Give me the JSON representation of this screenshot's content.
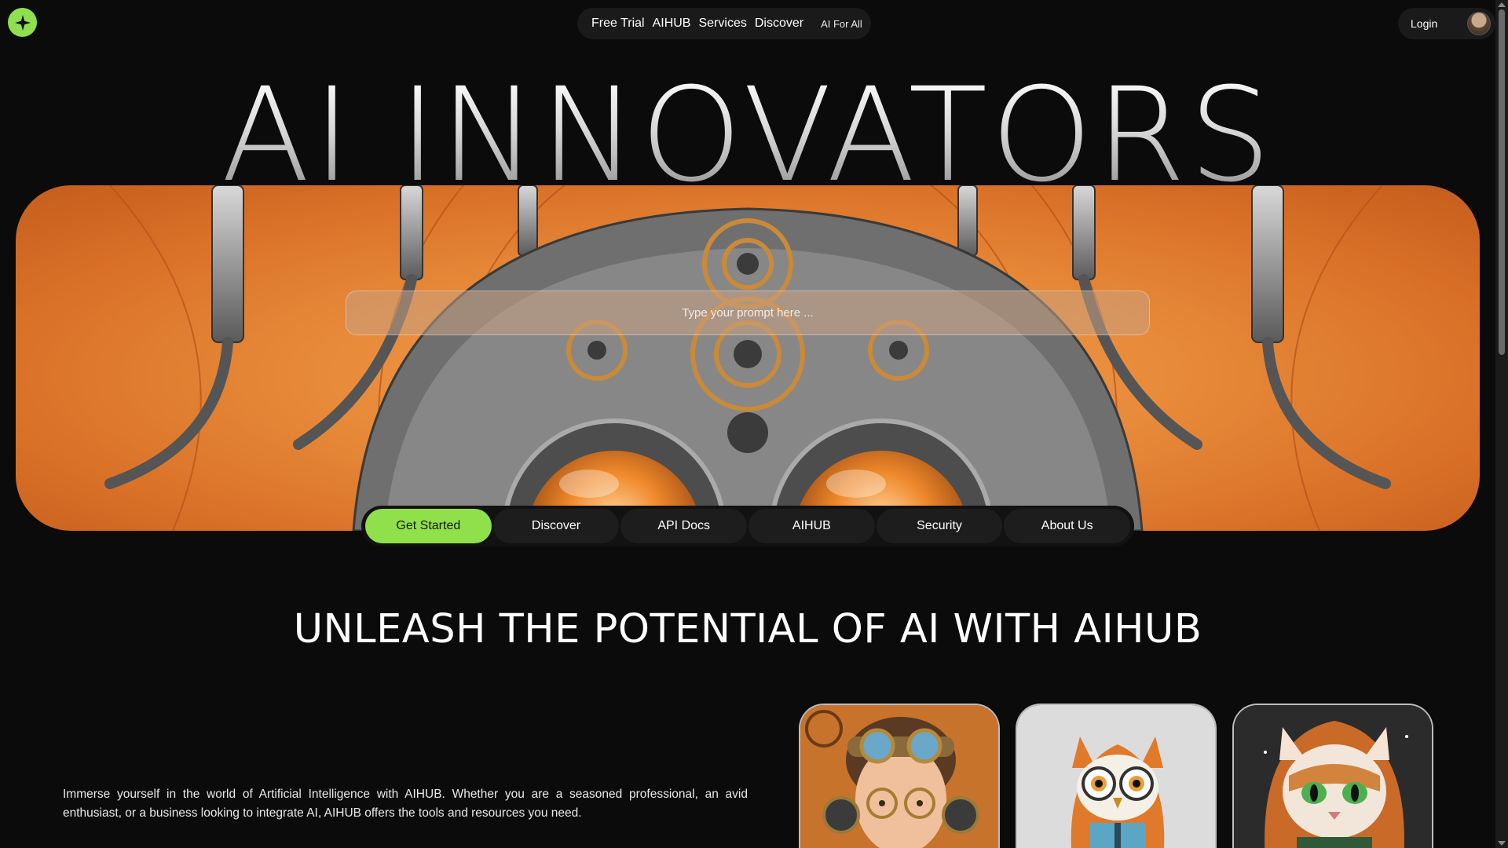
{
  "nav": {
    "logo_icon": "sparkle-icon",
    "items": [
      "Free Trial",
      "AIHUB",
      "Services",
      "Discover"
    ],
    "tagline": "AI For All",
    "accent_color": "#8ee04e"
  },
  "user": {
    "login_label": "Login",
    "avatar_icon": "user-avatar"
  },
  "hero": {
    "title": "AI INNOVATORS",
    "prompt_placeholder": "Type your prompt here ...",
    "image_theme": "steampunk-mechanical-robot-orange"
  },
  "tabs": [
    {
      "label": "Get Started",
      "active": true
    },
    {
      "label": "Discover",
      "active": false
    },
    {
      "label": "API Docs",
      "active": false
    },
    {
      "label": "AIHUB",
      "active": false
    },
    {
      "label": "Security",
      "active": false
    },
    {
      "label": "About Us",
      "active": false
    }
  ],
  "section": {
    "title": "UNLEASH THE POTENTIAL OF AI WITH AIHUB",
    "description": "Immerse yourself in the world of Artificial Intelligence with AIHUB. Whether you are a seasoned professional, an avid enthusiast, or a business looking to integrate AI, AIHUB offers the tools and resources you need."
  },
  "cards": [
    {
      "subject": "steampunk-boy-with-goggles"
    },
    {
      "subject": "owl-in-hoodie"
    },
    {
      "subject": "cat-in-orange-hood"
    }
  ]
}
